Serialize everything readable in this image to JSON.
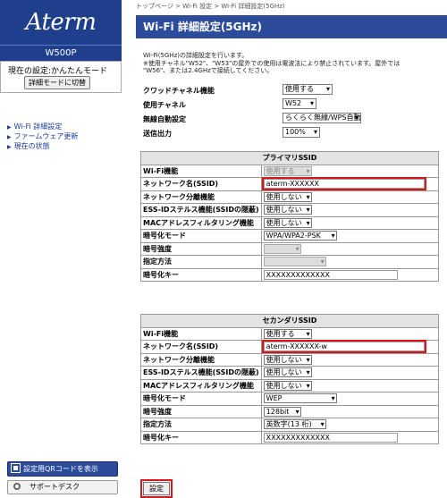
{
  "sidebar": {
    "logo": "Aterm",
    "model": "W500P",
    "mode_label": "現在の設定:かんたんモード",
    "mode_button": "詳細モードに切替",
    "nav": [
      {
        "label": "Wi-Fi 詳細設定"
      },
      {
        "label": "ファームウェア更新"
      },
      {
        "label": "現在の状態"
      }
    ],
    "qr_button": "設定用QRコードを表示",
    "support_button": "サポートデスク"
  },
  "main": {
    "breadcrumb": "トップページ > Wi-Fi 設定 > Wi-Fi 詳細設定(5GHz)",
    "title": "Wi-Fi 詳細設定(5GHz)",
    "intro": [
      "Wi-Fi(5GHz)の詳細設定を行います。",
      "※使用チャネル\"W52\"、\"W53\"の屋外での使用は電波法により禁止されています。屋外では",
      "\"W56\"、または2.4GHzで接続してください。"
    ],
    "settings": [
      {
        "label": "クワッドチャネル機能",
        "value": "使用する"
      },
      {
        "label": "使用チャネル",
        "value": "W52"
      },
      {
        "label": "無線自動設定",
        "value": "らくらく無線/WPS自動"
      },
      {
        "label": "送信出力",
        "value": "100%"
      }
    ],
    "primary": {
      "header": "プライマリSSID",
      "rows": [
        {
          "label": "Wi-Fi機能",
          "value": "使用する"
        },
        {
          "label": "ネットワーク名(SSID)",
          "value": "aterm-XXXXXX"
        },
        {
          "label": "ネットワーク分離機能",
          "value": "使用しない"
        },
        {
          "label": "ESS-IDステルス機能(SSIDの隠蔽)",
          "value": "使用しない"
        },
        {
          "label": "MACアドレスフィルタリング機能",
          "value": "使用しない"
        },
        {
          "label": "暗号化モード",
          "value": "WPA/WPA2-PSK"
        },
        {
          "label": "暗号強度",
          "value": ""
        },
        {
          "label": "指定方法",
          "value": ""
        },
        {
          "label": "暗号化キー",
          "value": "XXXXXXXXXXXXX"
        }
      ]
    },
    "secondary": {
      "header": "セカンダリSSID",
      "rows": [
        {
          "label": "Wi-Fi機能",
          "value": "使用する"
        },
        {
          "label": "ネットワーク名(SSID)",
          "value": "aterm-XXXXXX-w"
        },
        {
          "label": "ネットワーク分離機能",
          "value": "使用しない"
        },
        {
          "label": "ESS-IDステルス機能(SSIDの隠蔽)",
          "value": "使用しない"
        },
        {
          "label": "MACアドレスフィルタリング機能",
          "value": "使用しない"
        },
        {
          "label": "暗号化モード",
          "value": "WEP"
        },
        {
          "label": "暗号強度",
          "value": "128bit"
        },
        {
          "label": "指定方法",
          "value": "英数字(13 桁)"
        },
        {
          "label": "暗号化キー",
          "value": "XXXXXXXXXXXXX"
        }
      ]
    },
    "setting_button": "設定"
  }
}
